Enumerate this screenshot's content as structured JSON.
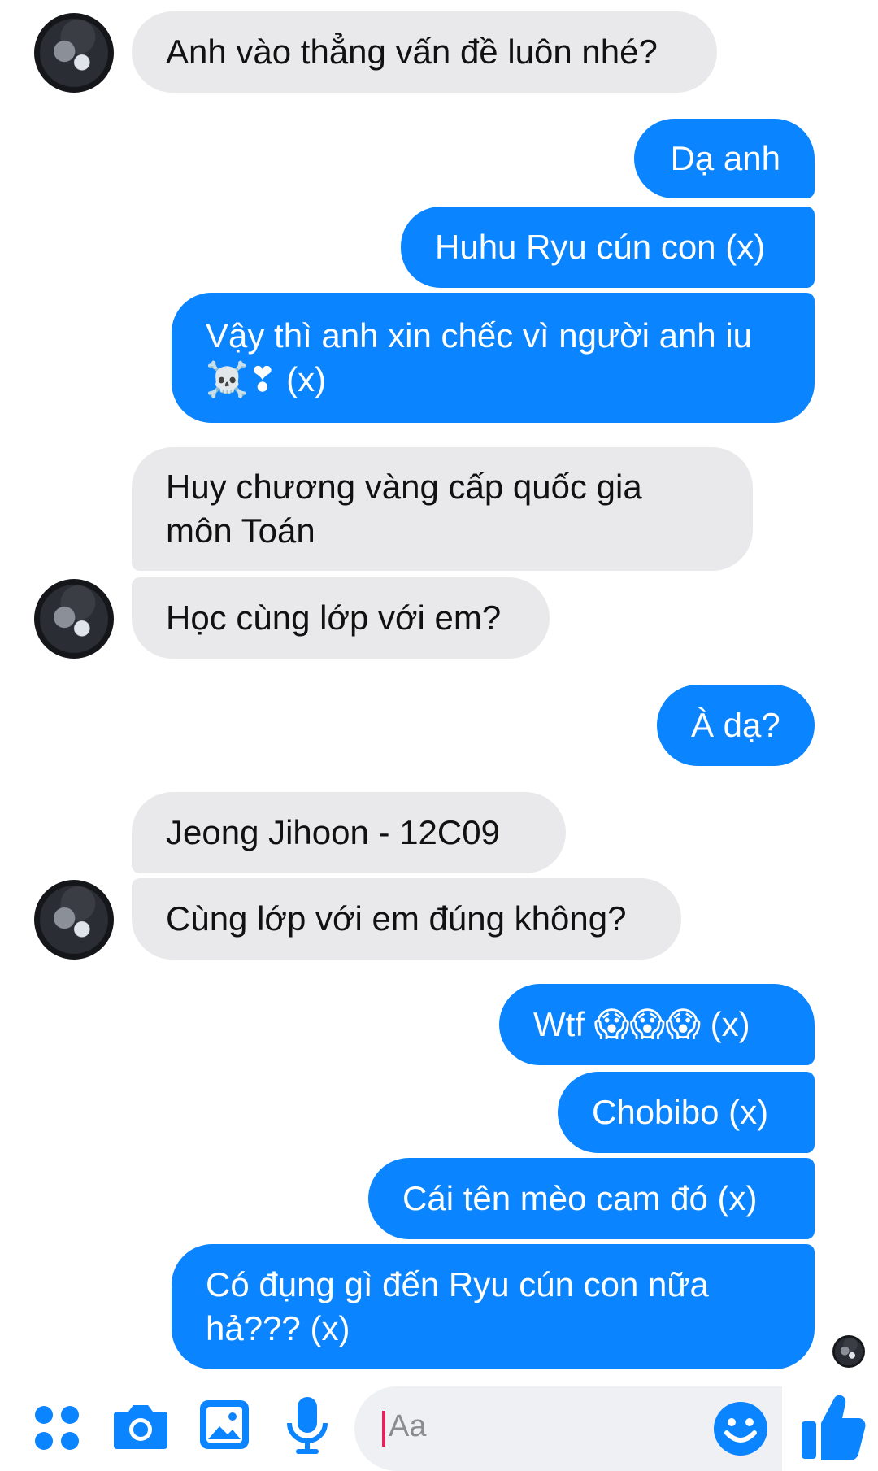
{
  "colors": {
    "incoming_bubble": "#e9e9eb",
    "outgoing_bubble": "#0b84ff",
    "accent": "#0b84ff"
  },
  "messages": [
    {
      "from": "them",
      "text": "Anh vào thẳng vấn đề luôn nhé?"
    },
    {
      "from": "me",
      "text": "Dạ anh"
    },
    {
      "from": "me",
      "text": "Huhu Ryu cún con (x)"
    },
    {
      "from": "me",
      "text": "Vậy thì anh xin chếc vì người anh iu",
      "line2": "☠️❣ (x)"
    },
    {
      "from": "them",
      "text": "Huy chương vàng cấp quốc gia\nmôn Toán"
    },
    {
      "from": "them",
      "text": "Học cùng lớp với em?"
    },
    {
      "from": "me",
      "text": "À dạ?"
    },
    {
      "from": "them",
      "text": "Jeong Jihoon - 12C09"
    },
    {
      "from": "them",
      "text": "Cùng lớp với em đúng không?"
    },
    {
      "from": "me",
      "text": "Wtf 😱😱😱 (x)"
    },
    {
      "from": "me",
      "text": "Chobibo (x)"
    },
    {
      "from": "me",
      "text": "Cái tên mèo cam đó (x)"
    },
    {
      "from": "me",
      "text": "Có đụng gì đến Ryu cún con nữa\nhả??? (x)"
    }
  ],
  "composer": {
    "placeholder": "Aa",
    "icons": [
      "apps-icon",
      "camera-icon",
      "gallery-icon",
      "microphone-icon",
      "emoji-icon",
      "thumbs-up-icon"
    ]
  }
}
